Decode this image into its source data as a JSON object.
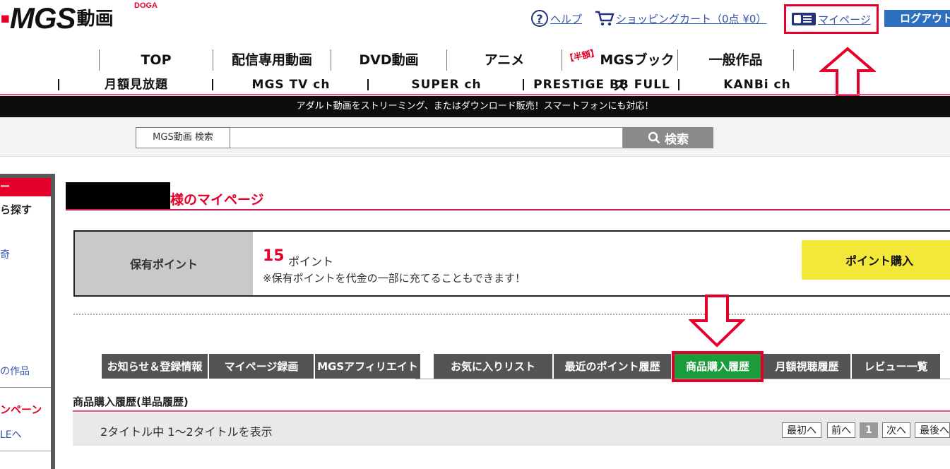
{
  "header": {
    "logo_text": "MGS",
    "logo_kanji": "動画",
    "logo_sub": "DOGA",
    "help": "ヘルプ",
    "cart": "ショッピングカート（0点 ¥0）",
    "mypage": "マイページ",
    "logout": "ログアウト"
  },
  "nav_main": {
    "items": [
      "TOP",
      "配信専用動画",
      "DVD動画",
      "アニメ",
      "MGSブックス",
      "一般作品"
    ],
    "books_badge": "【半額】"
  },
  "nav_sub": {
    "items": [
      "月額見放題",
      "MGS TV ch",
      "SUPER ch",
      "PRESTIGE BB FULL",
      "KANBi ch"
    ]
  },
  "banner": {
    "text": "アダルト動画をストリーミング、またはダウンロード販売！スマートフォンにも対応！"
  },
  "search": {
    "label": "MGS動画 検索",
    "value": "",
    "button": "検索"
  },
  "sidebar": {
    "header": "ー",
    "line1": "ら探す",
    "line2": "奇",
    "line3": "の作品",
    "line4": "ンペーン",
    "line5": "LEへ"
  },
  "mypage": {
    "title_suffix": "様のマイページ",
    "points_label": "保有ポイント",
    "points_value": "15",
    "points_unit": "ポイント",
    "points_note": "※保有ポイントを代金の一部に充てることもできます！",
    "buy_button": "ポイント購入"
  },
  "tabs": [
    {
      "label": "お知らせ＆登録情報",
      "active": false
    },
    {
      "label": "マイページ録画",
      "active": false
    },
    {
      "label": "MGSアフィリエイト",
      "active": false
    },
    {
      "label": "お気に入りリスト",
      "active": false
    },
    {
      "label": "最近のポイント履歴",
      "active": false
    },
    {
      "label": "商品購入履歴",
      "active": true
    },
    {
      "label": "月額視聴履歴",
      "active": false
    },
    {
      "label": "レビュー一覧",
      "active": false
    }
  ],
  "history": {
    "title": "商品購入履歴(単品履歴)",
    "count_text": "2タイトル中 1～2タイトルを表示",
    "pager": {
      "first": "最初へ",
      "prev": "前へ",
      "current": "1",
      "next": "次へ",
      "last": "最後へ"
    }
  },
  "colors": {
    "brand_red": "#e4002b",
    "accent_pink": "#e94d8a",
    "tab_active_green": "#1a9c3a",
    "logout_blue": "#2d6fbe",
    "buy_yellow": "#f3e83a"
  }
}
